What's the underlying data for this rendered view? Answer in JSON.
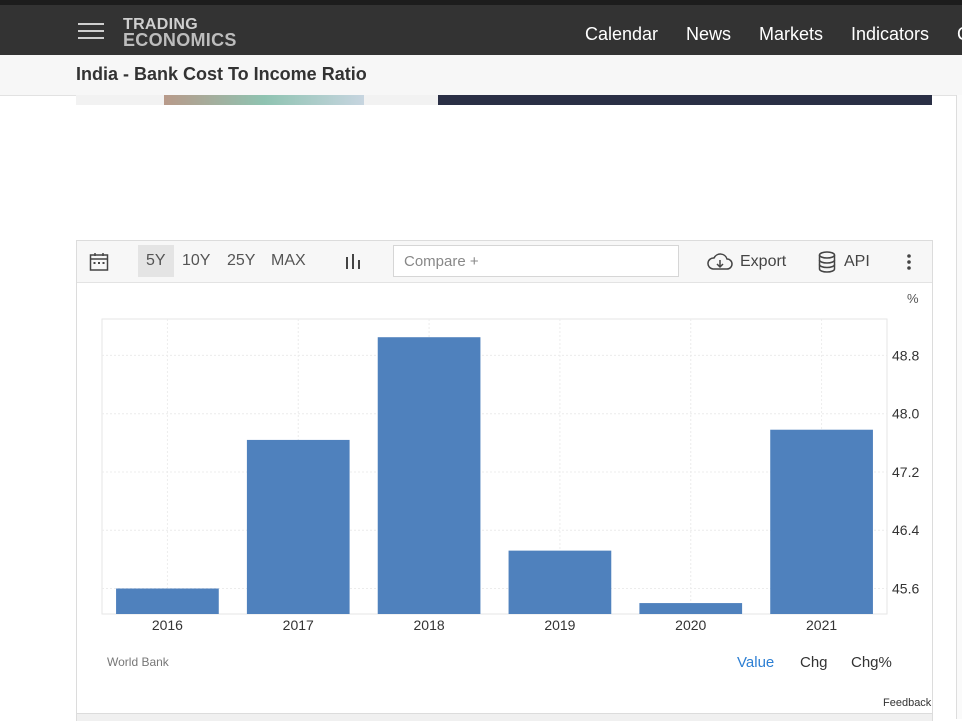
{
  "brand": {
    "line1": "TRADING",
    "line2": "ECONOMICS"
  },
  "nav": {
    "items": [
      "Calendar",
      "News",
      "Markets",
      "Indicators",
      "C"
    ]
  },
  "page": {
    "title": "India - Bank Cost To Income Ratio"
  },
  "toolbar": {
    "ranges": [
      "5Y",
      "10Y",
      "25Y",
      "MAX"
    ],
    "active_range": "5Y",
    "compare_placeholder": "Compare +",
    "export_label": "Export",
    "api_label": "API"
  },
  "chart_data": {
    "type": "bar",
    "categories": [
      "2016",
      "2017",
      "2018",
      "2019",
      "2020",
      "2021"
    ],
    "values": [
      45.6,
      47.64,
      49.05,
      46.12,
      45.4,
      47.78
    ],
    "unit": "%",
    "ylim": [
      45.25,
      49.3
    ],
    "yticks": [
      "45.6",
      "46.4",
      "47.2",
      "48.0",
      "48.8"
    ],
    "ytick_values": [
      45.6,
      46.4,
      47.2,
      48.0,
      48.8
    ],
    "color": "#4f81bd",
    "grid": true
  },
  "footer": {
    "source": "World Bank",
    "tabs": [
      "Value",
      "Chg",
      "Chg%"
    ],
    "active_tab": "Value",
    "feedback": "Feedback"
  },
  "colors": {
    "accent": "#4f81bd",
    "active_tab": "#2d7fd3",
    "navbar": "#333333"
  }
}
